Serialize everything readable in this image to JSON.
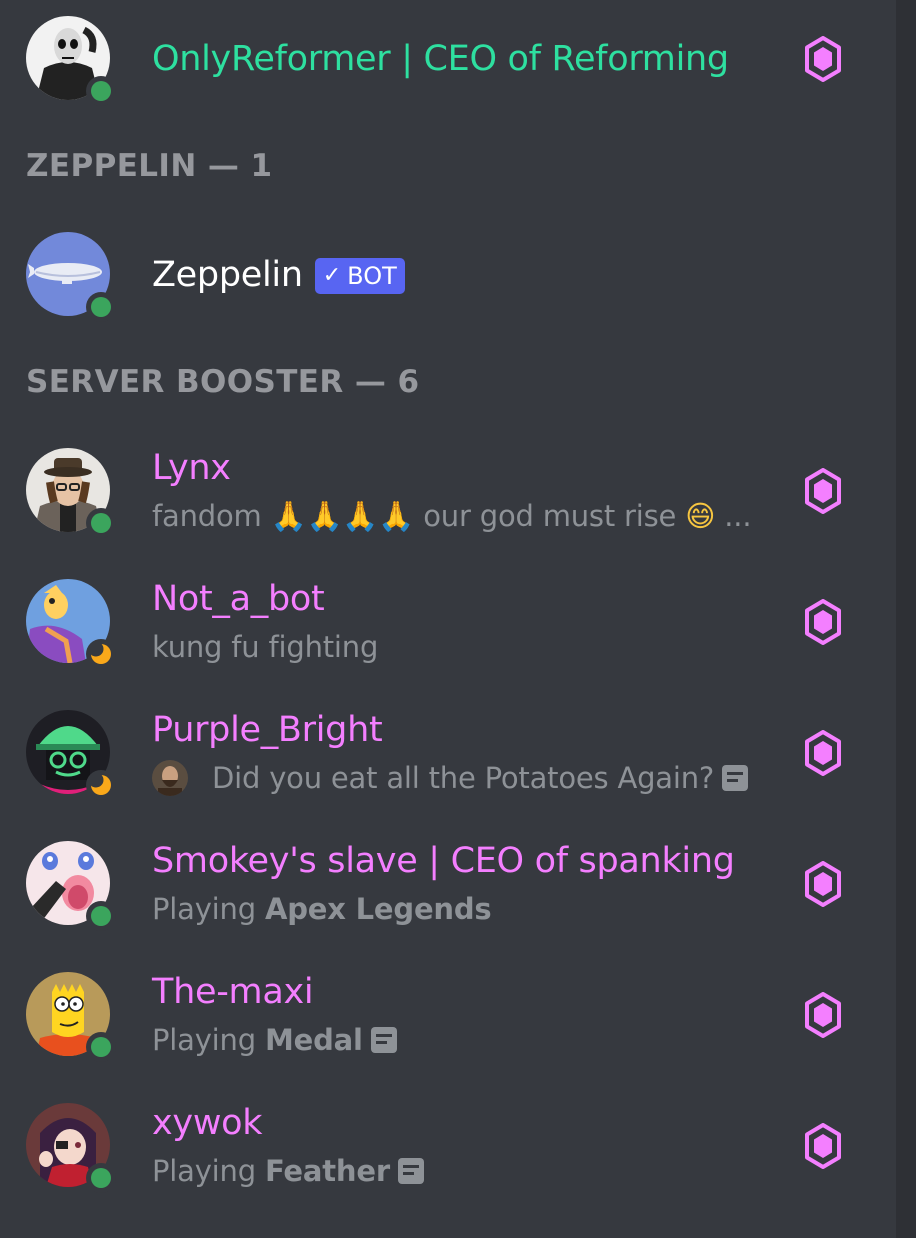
{
  "colors": {
    "background": "#36393f",
    "online": "#3ba55d",
    "idle": "#faa81a",
    "owner_name": "#2ee0a0",
    "booster_name": "#f47fff",
    "bot_name": "#ffffff",
    "muted_text": "#8e9297",
    "section_header": "#96989d",
    "bot_tag": "#5865f2",
    "boost_icon": "#f47fff"
  },
  "top_member": {
    "name": "OnlyReformer | CEO of Reforming",
    "status": "online",
    "avatar_icon": "masked-person-avatar",
    "boost_icon": "server-boost-icon"
  },
  "sections": [
    {
      "title": "ZEPPELIN — 1",
      "members": [
        {
          "name": "Zeppelin",
          "tag": "BOT",
          "tag_check": "✓",
          "status": "online",
          "avatar_icon": "zeppelin-airship-avatar"
        }
      ]
    },
    {
      "title": "SERVER BOOSTER — 6",
      "members": [
        {
          "name": "Lynx",
          "activity_text_1": "fandom",
          "activity_emoji": "🙏🙏🙏🙏",
          "activity_text_2": "our god must rise",
          "activity_emoji_2": "😄",
          "activity_ellipsis": "...",
          "status": "online",
          "avatar_icon": "hat-person-avatar",
          "boost_icon": "server-boost-icon"
        },
        {
          "name": "Not_a_bot",
          "activity": "kung fu fighting",
          "status": "idle",
          "avatar_icon": "cartoon-character-avatar",
          "boost_icon": "server-boost-icon"
        },
        {
          "name": "Purple_Bright",
          "activity": "Did you eat all the Potatoes Again?",
          "status": "idle",
          "avatar_icon": "green-helmet-character-avatar",
          "boost_icon": "server-boost-icon"
        },
        {
          "name": "Smokey's slave | CEO of spanking",
          "activity_prefix": "Playing",
          "activity_game": "Apex Legends",
          "status": "online",
          "avatar_icon": "anime-character-avatar",
          "boost_icon": "server-boost-icon"
        },
        {
          "name": "The-maxi",
          "activity_prefix": "Playing",
          "activity_game": "Medal",
          "status": "online",
          "avatar_icon": "bart-simpson-avatar",
          "boost_icon": "server-boost-icon"
        },
        {
          "name": "xywok",
          "activity_prefix": "Playing",
          "activity_game": "Feather",
          "status": "online",
          "avatar_icon": "anime-girl-avatar",
          "boost_icon": "server-boost-icon"
        }
      ]
    }
  ]
}
